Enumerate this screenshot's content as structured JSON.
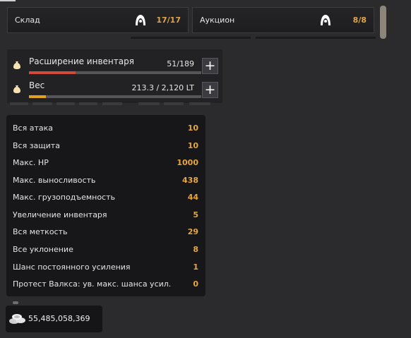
{
  "storage": {
    "warehouse_label": "Склад",
    "warehouse_count": "17/17",
    "warehouse_icon": "pet-icon",
    "auction_label": "Аукцион",
    "auction_count": "8/8",
    "auction_icon": "pet-icon"
  },
  "inventory": {
    "expansion_label": "Расширение инвентаря",
    "expansion_value": "51/189",
    "expansion_fraction": 0.27,
    "expansion_color": "#d14b3b",
    "weight_label": "Вес",
    "weight_value": "213.3 / 2,120 LT",
    "weight_fraction": 0.1,
    "weight_color": "#e0a020",
    "plus_symbol": "+",
    "bag_icon": "money-bag-icon"
  },
  "stats": [
    {
      "name": "Вся атака",
      "value": "10"
    },
    {
      "name": "Вся защита",
      "value": "10"
    },
    {
      "name": "Макс. HP",
      "value": "1000"
    },
    {
      "name": "Макс. выносливость",
      "value": "438"
    },
    {
      "name": "Макс. грузоподъемность",
      "value": "44"
    },
    {
      "name": "Увеличение инвентаря",
      "value": "5"
    },
    {
      "name": "Вся меткость",
      "value": "29"
    },
    {
      "name": "Все уклонение",
      "value": "8"
    },
    {
      "name": "Шанс постоянного усиления",
      "value": "1"
    },
    {
      "name": "Протест Валкса: ув. макс. шанса усил.",
      "value": "0"
    }
  ],
  "silver": {
    "amount": "55,485,058,369",
    "icon": "silver-coins-icon"
  },
  "colors": {
    "accent_orange": "#e5a642",
    "background": "#2b2b2d",
    "panel": "#17171a"
  }
}
